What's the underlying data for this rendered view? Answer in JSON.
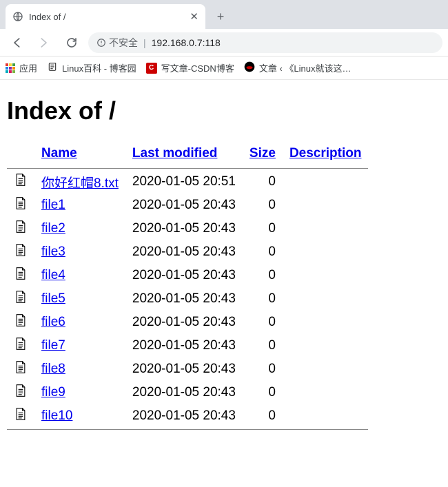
{
  "tab": {
    "title": "Index of /"
  },
  "toolbar": {
    "insecure_label": "不安全",
    "url": "192.168.0.7:118"
  },
  "bookmarks": {
    "apps_label": "应用",
    "items": [
      {
        "label": "Linux百科 - 博客园",
        "icon": "script"
      },
      {
        "label": "写文章-CSDN博客",
        "icon": "c"
      },
      {
        "label": "文章 ‹ 《Linux就该这…",
        "icon": "rh"
      }
    ]
  },
  "page": {
    "heading": "Index of /",
    "columns": {
      "name": "Name",
      "modified": "Last modified",
      "size": "Size",
      "description": "Description"
    },
    "files": [
      {
        "name": "你好红帽8.txt",
        "modified": "2020-01-05 20:51",
        "size": "0"
      },
      {
        "name": "file1",
        "modified": "2020-01-05 20:43",
        "size": "0"
      },
      {
        "name": "file2",
        "modified": "2020-01-05 20:43",
        "size": "0"
      },
      {
        "name": "file3",
        "modified": "2020-01-05 20:43",
        "size": "0"
      },
      {
        "name": "file4",
        "modified": "2020-01-05 20:43",
        "size": "0"
      },
      {
        "name": "file5",
        "modified": "2020-01-05 20:43",
        "size": "0"
      },
      {
        "name": "file6",
        "modified": "2020-01-05 20:43",
        "size": "0"
      },
      {
        "name": "file7",
        "modified": "2020-01-05 20:43",
        "size": "0"
      },
      {
        "name": "file8",
        "modified": "2020-01-05 20:43",
        "size": "0"
      },
      {
        "name": "file9",
        "modified": "2020-01-05 20:43",
        "size": "0"
      },
      {
        "name": "file10",
        "modified": "2020-01-05 20:43",
        "size": "0"
      }
    ]
  }
}
